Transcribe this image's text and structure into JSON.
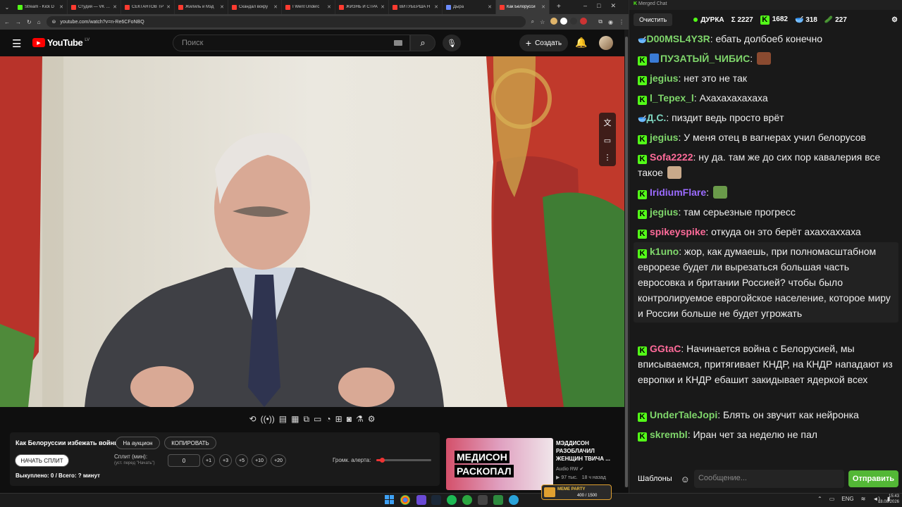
{
  "browser": {
    "tabs": [
      {
        "title": "Stream - Kick D",
        "color": "#53fc18"
      },
      {
        "title": "Студия — VK Ви",
        "color": "#ff3b30"
      },
      {
        "title": "СЕКТАНТОВ ТР",
        "color": "#ff3b30"
      },
      {
        "title": "Жилиль и Мэд",
        "color": "#ff3b30"
      },
      {
        "title": "Скандал вокру",
        "color": "#ff3b30"
      },
      {
        "title": "I Went Underc",
        "color": "#ff3b30"
      },
      {
        "title": "ЖИЗНЬ И СТРА",
        "color": "#ff3b30"
      },
      {
        "title": "ВИТУБЕРША Н",
        "color": "#ff3b30"
      },
      {
        "title": "Дыра",
        "color": "#6b8cff"
      },
      {
        "title": "Как Белорусси",
        "color": "#ff3b30",
        "active": true
      }
    ],
    "url": "youtube.com/watch?v=n-Re6CFoNBQ"
  },
  "youtube": {
    "logo_text": "YouTube",
    "region": "LV",
    "search_placeholder": "Поиск",
    "create_label": "Создать"
  },
  "extension": {
    "video_title": "Как Белоруссии избежать войны",
    "auction_label": "На аукцион",
    "copy_label": "КОПИРОВАТЬ",
    "start_split_label": "НАЧАТЬ СПЛИТ",
    "split_label": "Сплит (мин):",
    "split_hint": "(уст. перед \"Начать\")",
    "split_value": "0",
    "increments": [
      "+1",
      "+3",
      "+5",
      "+10",
      "+20"
    ],
    "alert_volume_label": "Громк. алерта:",
    "alert_volume": 0.1,
    "status": "Выкуплено: 0 / Всего: ? минут"
  },
  "recommendation": {
    "thumb_text_1": "МЕДИСОН",
    "thumb_text_2": "РАСКОПАЛ",
    "title_line1": "МЭДДИСОН",
    "title_line2": "РАЗОБЛАЧИЛ",
    "title_line3": "ЖЕНЩИН ТВИЧА ...",
    "channel": "Audio RW",
    "views": "97 тыс.",
    "age": "18 ч назад"
  },
  "chat": {
    "window_title": "Merged Chat",
    "clear_label": "Очистить",
    "channel": "ДУРКА",
    "stats": [
      "2227",
      "1682",
      "318",
      "227"
    ],
    "messages": [
      {
        "name": "D00MSL4Y3R",
        "color": "#7fd66b",
        "text": "ебать долбоеб конечно",
        "badge": "other"
      },
      {
        "name": "ПУЗАТЫЙ_ЧИБИС",
        "color": "#7fd66b",
        "text": "",
        "badge": "k",
        "emote": "#8a4a30"
      },
      {
        "name": "jegius",
        "color": "#7fd66b",
        "text": "нет это не так",
        "badge": "k"
      },
      {
        "name": "l_Tepex_l",
        "color": "#7fd66b",
        "text": "Ахахахахахаха",
        "badge": "k"
      },
      {
        "name": "Д.С.",
        "color": "#7fd6c0",
        "text": "пиздит ведь просто врёт",
        "badge": "other"
      },
      {
        "name": "jegius",
        "color": "#7fd66b",
        "text": "У меня отец в вагнерах учил белорусов",
        "badge": "k"
      },
      {
        "name": "Sofa2222",
        "color": "#ff6b9a",
        "text": "ну да. там же до сих пор кавалерия все такое",
        "badge": "k",
        "emote": "#c9a98a"
      },
      {
        "name": "IridiumFlare",
        "color": "#9b6bff",
        "text": "",
        "badge": "k",
        "emote": "#6a9a4a"
      },
      {
        "name": "jegius",
        "color": "#7fd66b",
        "text": "там серьезные прогресс",
        "badge": "k"
      },
      {
        "name": "spikeyspike",
        "color": "#ff6b9a",
        "text": "откуда он это берёт ахаххаххаха",
        "badge": "k"
      },
      {
        "name": "k1uno",
        "color": "#7fd66b",
        "text": "жор, как думаешь, при полномасштабном еврорезе будет ли вырезаться большая часть евросовка и британии Россией? чтобы было контролируемое еврогойское население, которое миру и России больше не будет угрожать",
        "badge": "k"
      },
      {
        "name": "GGtaC",
        "color": "#ff6b9a",
        "text": "Начинается война с Белорусией, мы вписываемся, притягивает КНДР, на КНДР нападают из европки и КНДР ебашит закидывает ядеркой всех",
        "badge": "k"
      },
      {
        "name": "UnderTaleJopi",
        "color": "#7fd66b",
        "text": "Блять он звучит как нейронка",
        "badge": "k"
      },
      {
        "name": "skrembl",
        "color": "#7fd66b",
        "text": "Иран чет за неделю не пал",
        "badge": "k"
      }
    ],
    "templates_label": "Шаблоны",
    "input_placeholder": "Сообщение...",
    "send_label": "Отправить"
  },
  "taskbar": {
    "lang": "ENG",
    "time": "15:43",
    "date": "18.08.2026",
    "overlay_label": "MEME PARTY",
    "overlay_count": "400 / 1500"
  }
}
